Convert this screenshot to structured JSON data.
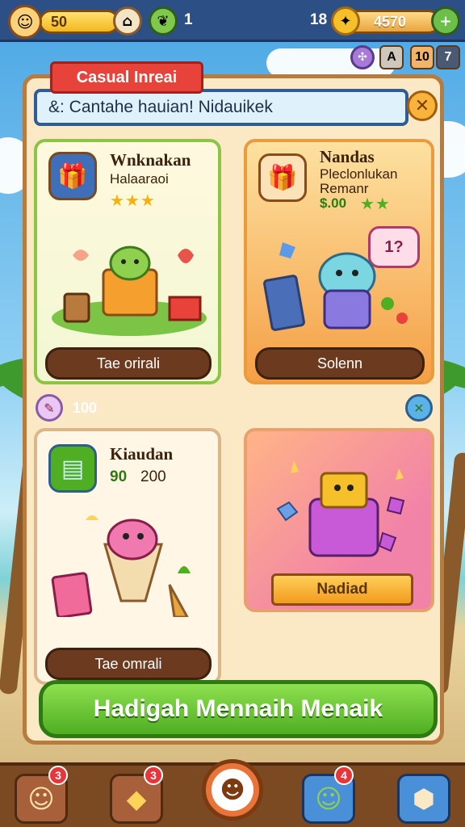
{
  "top": {
    "gold": "50",
    "level": "1",
    "gems": "18",
    "coins": "4570",
    "small_buttons": [
      "A",
      "10",
      "7"
    ]
  },
  "panel": {
    "ribbon": "Casual Inreai",
    "message": "&: Cantahe hauian! Nidauikek",
    "close_icon": "close-icon"
  },
  "cards": [
    {
      "title": "Wnknakan",
      "subtitle": "Halaaraoi",
      "stars": "★★★",
      "button": "Tae orirali"
    },
    {
      "title": "Nandas",
      "subtitle_1": "Pleclonlukan",
      "subtitle_2": "Remanr",
      "price": "$.00",
      "stars": "★★",
      "badge": "1?",
      "button": "Solenn"
    },
    {
      "title": "Kiaudan",
      "value_1": "90",
      "value_2": "200",
      "button": "Tae omrali"
    },
    {
      "button": "Nadiad"
    }
  ],
  "middle_row": {
    "value": "100"
  },
  "claim_button": "Hadigah Mennaih Menaik",
  "bottom_nav": [
    {
      "icon": "character-icon",
      "badge": "3"
    },
    {
      "icon": "cat-icon",
      "badge": "3"
    },
    {
      "icon": "home-face-icon",
      "badge": ""
    },
    {
      "icon": "friend-icon",
      "badge": "4"
    },
    {
      "icon": "dice-icon",
      "badge": ""
    }
  ],
  "colors": {
    "accent_green": "#4fae22",
    "ribbon_red": "#e8433a",
    "bar_blue": "#2c4f86",
    "brown": "#7b4a22"
  }
}
